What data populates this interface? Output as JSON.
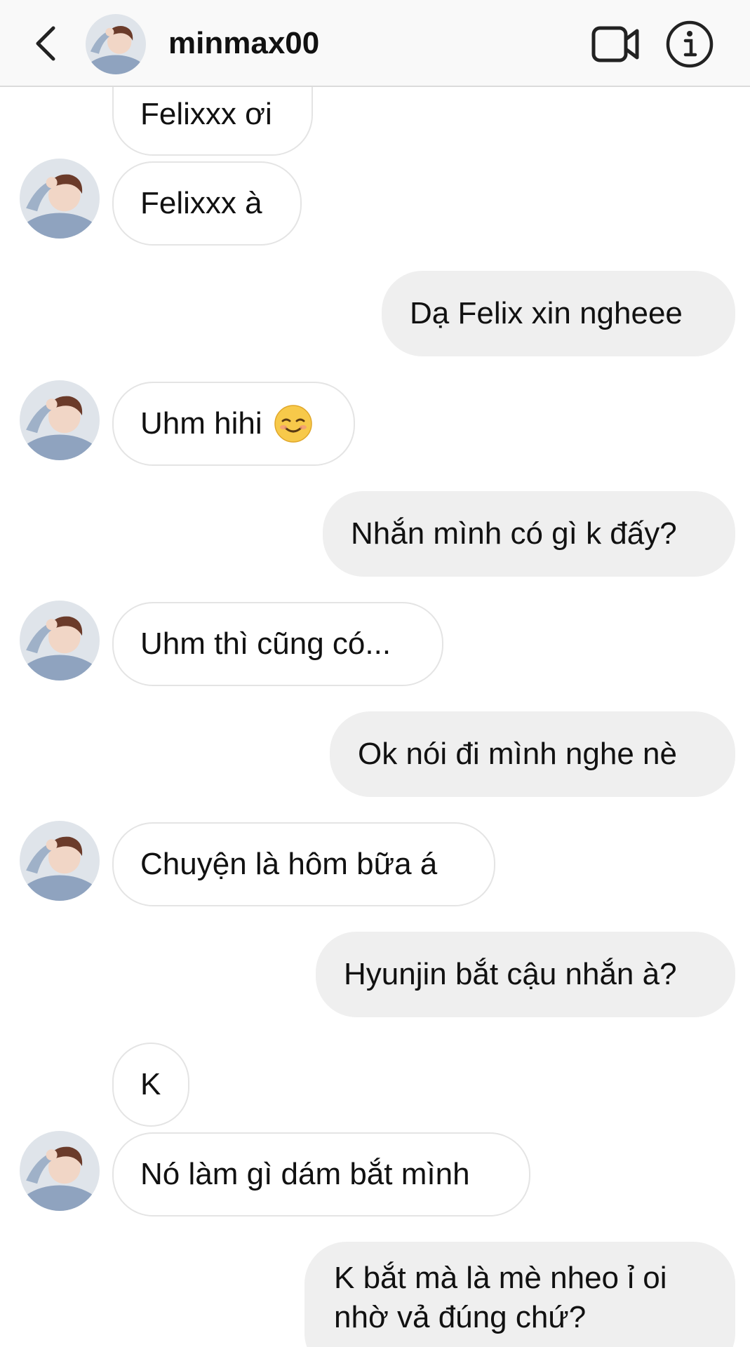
{
  "header": {
    "username": "minmax00",
    "back_icon": "chevron-left-icon",
    "video_icon": "video-camera-icon",
    "info_icon": "info-icon"
  },
  "messages": [
    {
      "from": "them",
      "text": "Felixxx ơi"
    },
    {
      "from": "them",
      "text": "Felixxx à"
    },
    {
      "from": "me",
      "text": "Dạ Felix xin ngheee"
    },
    {
      "from": "them",
      "text": "Uhm hihi",
      "emoji": "smiling-face-icon"
    },
    {
      "from": "me",
      "text": "Nhắn mình có gì k đấy?"
    },
    {
      "from": "them",
      "text": "Uhm thì cũng có..."
    },
    {
      "from": "me",
      "text": "Ok nói đi mình nghe nè"
    },
    {
      "from": "them",
      "text": "Chuyện là hôm bữa á"
    },
    {
      "from": "me",
      "text": "Hyunjin bắt cậu nhắn à?"
    },
    {
      "from": "them",
      "text": "K"
    },
    {
      "from": "them",
      "text": "Nó làm gì dám bắt mình"
    },
    {
      "from": "me",
      "text": "K bắt mà là mè nheo ỉ oi nhờ vả đúng chứ?"
    }
  ],
  "colors": {
    "incoming_bg": "#ffffff",
    "incoming_border": "#e4e4e4",
    "outgoing_bg": "#efefef",
    "header_bg": "#f9f9f9",
    "divider": "#dbdbdb"
  }
}
